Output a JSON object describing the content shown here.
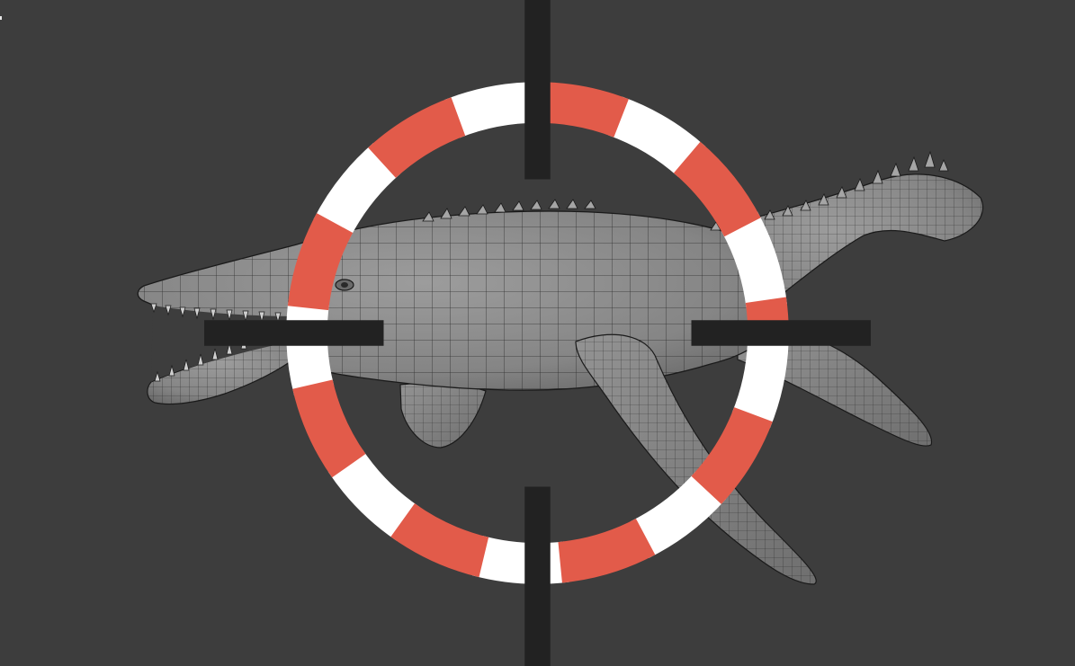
{
  "viewport": {
    "background_color": "#3d3d3d",
    "mesh_fill_color": "#8f8f8f",
    "mesh_wire_color": "#1a1a1a",
    "object_shape": "pliosaur-marine-reptile",
    "cursor_icon": "3d-cursor-icon",
    "cursor_colors": [
      "#e25b4a",
      "#ffffff"
    ]
  }
}
